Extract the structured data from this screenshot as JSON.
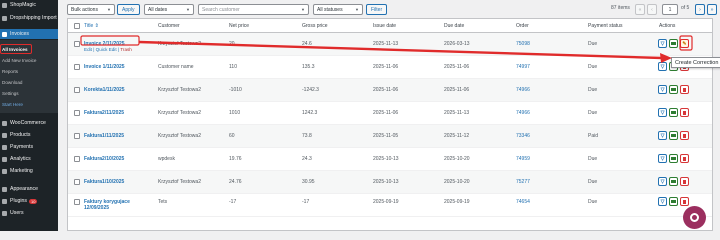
{
  "sidebar": {
    "items": [
      {
        "label": "ShopMagic",
        "icon": "shopmagic-icon"
      },
      {
        "label": "Dropshipping Import",
        "icon": "dropshipping-icon"
      },
      {
        "label": "Invoices",
        "icon": "invoices-icon"
      },
      {
        "label": "WooCommerce",
        "icon": "woocommerce-icon"
      },
      {
        "label": "Products",
        "icon": "products-icon"
      },
      {
        "label": "Payments",
        "icon": "payments-icon"
      },
      {
        "label": "Analytics",
        "icon": "analytics-icon"
      },
      {
        "label": "Marketing",
        "icon": "marketing-icon"
      },
      {
        "label": "Appearance",
        "icon": "appearance-icon"
      },
      {
        "label": "Plugins",
        "icon": "plugins-icon",
        "badge": "10"
      },
      {
        "label": "Users",
        "icon": "users-icon"
      }
    ],
    "submenu": [
      "All Invoices",
      "Add New Invoice",
      "Reports",
      "Download",
      "Settings",
      "Start Here"
    ]
  },
  "toolbar": {
    "bulk_actions": "Bulk actions",
    "apply": "Apply",
    "all_dates": "All dates",
    "search_placeholder": "Search customer",
    "all_statuses": "All statuses",
    "filter": "Filter",
    "items_count": "87 items",
    "page_first": "«",
    "page_prev": "‹",
    "page_current": "1",
    "page_of": "of 5",
    "page_next": "›",
    "page_last": "»"
  },
  "table": {
    "headers": [
      "Title",
      "Customer",
      "Net price",
      "Gross price",
      "Issue date",
      "Due date",
      "Order",
      "Payment status",
      "Actions"
    ],
    "row_links": {
      "edit": "Edit",
      "quick_edit": "Quick Edit",
      "trash": "Trash"
    },
    "rows": [
      {
        "title": "Invoice 2/11/2025",
        "customer": "Krzysztof Testowa2",
        "net": "20",
        "gross": "24.6",
        "issue": "2025-11-13",
        "due": "2026-03-13",
        "order": "75098",
        "status": "Due"
      },
      {
        "title": "Invoice 1/11/2025",
        "customer": "Customer name",
        "net": "110",
        "gross": "135.3",
        "issue": "2025-11-06",
        "due": "2025-11-06",
        "order": "74997",
        "status": "Due"
      },
      {
        "title": "Korekta1/11/2025",
        "customer": "Krzysztof Testowa2",
        "net": "-1010",
        "gross": "-1242.3",
        "issue": "2025-11-06",
        "due": "2025-11-06",
        "order": "74966",
        "status": "Due"
      },
      {
        "title": "Faktura2/11/2025",
        "customer": "Krzysztof Testowa2",
        "net": "1010",
        "gross": "1242.3",
        "issue": "2025-11-06",
        "due": "2025-11-13",
        "order": "74966",
        "status": "Due"
      },
      {
        "title": "Faktura1/11/2025",
        "customer": "Krzysztof Testowa2",
        "net": "60",
        "gross": "73.8",
        "issue": "2025-11-05",
        "due": "2025-11-12",
        "order": "73346",
        "status": "Paid"
      },
      {
        "title": "Faktura2/10/2025",
        "customer": "wpdesk",
        "net": "19.76",
        "gross": "24.3",
        "issue": "2025-10-13",
        "due": "2025-10-20",
        "order": "74959",
        "status": "Due"
      },
      {
        "title": "Faktura1/10/2025",
        "customer": "Krzysztof Testowa2",
        "net": "24.76",
        "gross": "30.95",
        "issue": "2025-10-13",
        "due": "2025-10-20",
        "order": "75277",
        "status": "Due"
      },
      {
        "title": "Faktury korygujace 12/09/2025",
        "customer": "Tets",
        "net": "-17",
        "gross": "-17",
        "issue": "2025-09-19",
        "due": "2025-09-19",
        "order": "74654",
        "status": "Due"
      }
    ]
  },
  "tooltip": "Create Correction",
  "colors": {
    "accent": "#2271b1",
    "sidebar": "#1d2327",
    "highlight": "#e02b2b",
    "help": "#9b2f5f"
  }
}
